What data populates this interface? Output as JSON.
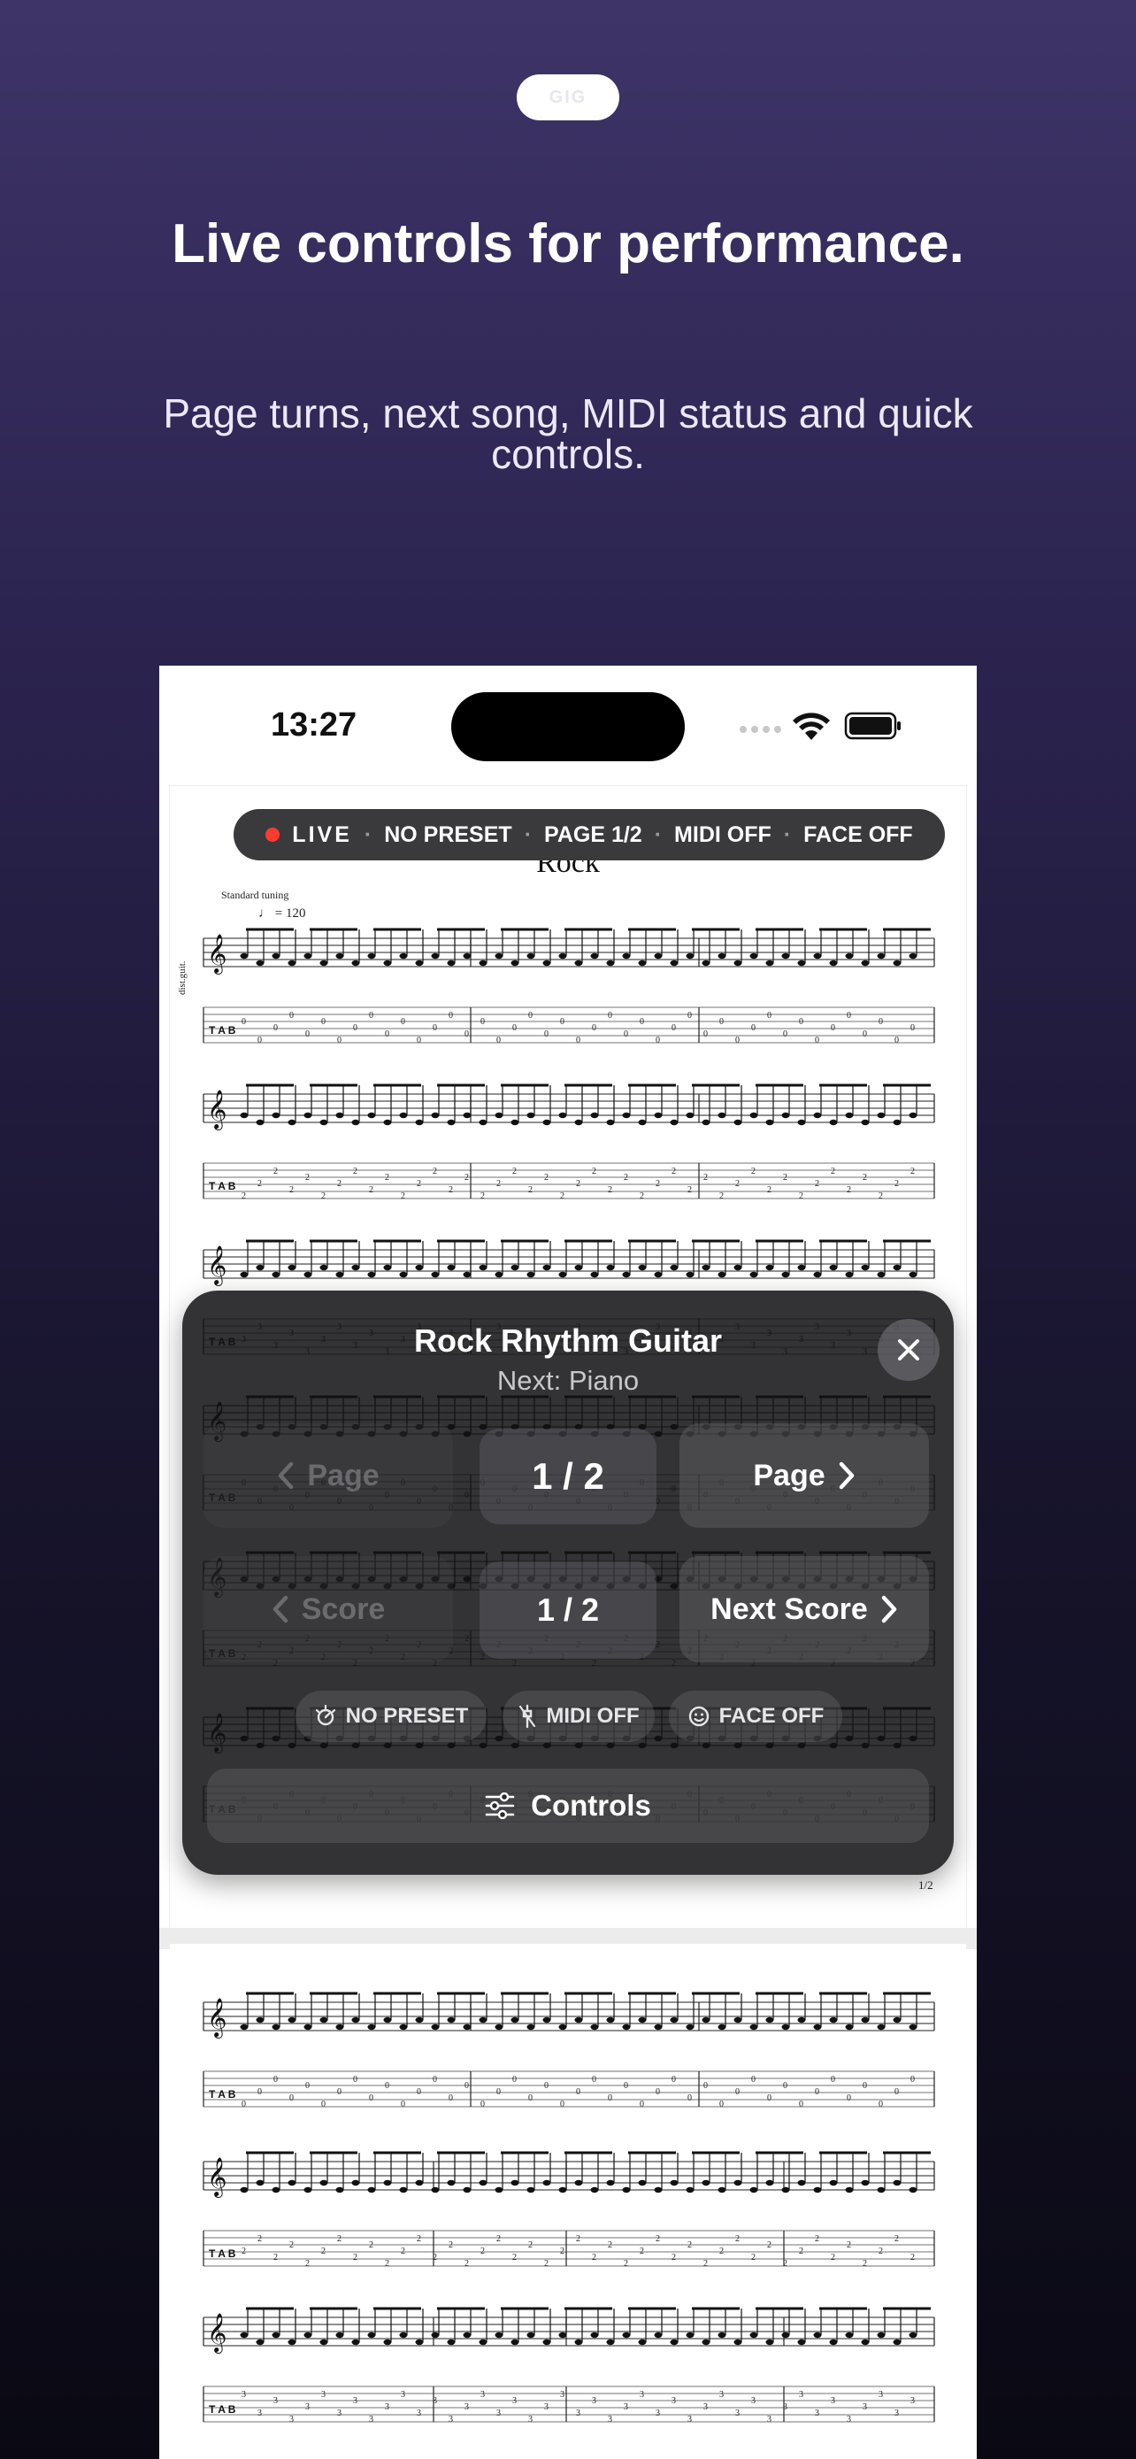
{
  "badge": {
    "label": "GIG"
  },
  "headline": "Live controls for performance.",
  "subhead": "Page turns, next song, MIDI status and quick controls.",
  "status_bar": {
    "time": "13:27"
  },
  "score": {
    "title": "Rock",
    "tuning": "Standard tuning",
    "tempo": "♩ = 120",
    "instrument_label": "dist.guit.",
    "page_number": "1/2"
  },
  "live_bar": {
    "live": "LIVE",
    "preset": "NO PRESET",
    "page": "PAGE 1/2",
    "midi": "MIDI OFF",
    "face": "FACE OFF",
    "separator": "·"
  },
  "panel": {
    "title": "Rock Rhythm Guitar",
    "subtitle": "Next: Piano",
    "prev_page": "Page",
    "page_counter": "1 / 2",
    "next_page": "Page",
    "prev_score": "Score",
    "score_counter": "1 / 2",
    "next_score": "Next Score",
    "chips": {
      "preset": "NO PRESET",
      "midi": "MIDI OFF",
      "face": "FACE OFF"
    },
    "controls": "Controls"
  },
  "colors": {
    "live_dot": "#ff3b30",
    "panel_bg": "#121214",
    "accent_bg": "#3e3468"
  }
}
